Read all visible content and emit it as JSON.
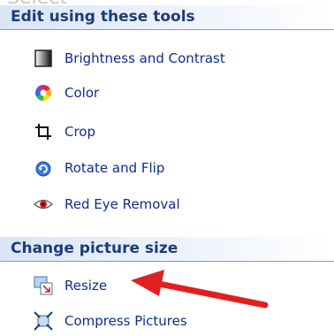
{
  "top_text_fragment": "Select",
  "sections": [
    {
      "header": "Edit using these tools",
      "items": [
        {
          "label": "Brightness and Contrast",
          "icon": "brightness-contrast-icon"
        },
        {
          "label": "Color",
          "icon": "color-wheel-icon"
        },
        {
          "label": "Crop",
          "icon": "crop-icon"
        },
        {
          "label": "Rotate and Flip",
          "icon": "rotate-flip-icon"
        },
        {
          "label": "Red Eye Removal",
          "icon": "red-eye-icon"
        }
      ]
    },
    {
      "header": "Change picture size",
      "items": [
        {
          "label": "Resize",
          "icon": "resize-icon"
        },
        {
          "label": "Compress Pictures",
          "icon": "compress-icon"
        }
      ]
    }
  ],
  "annotation": {
    "type": "arrow",
    "color": "#e02020",
    "points_to": "Resize"
  },
  "colors": {
    "link_text": "#0f2d8c",
    "header_text": "#1c3c78",
    "header_gradient_start": "#d9e6f7",
    "arrow": "#e02020"
  }
}
